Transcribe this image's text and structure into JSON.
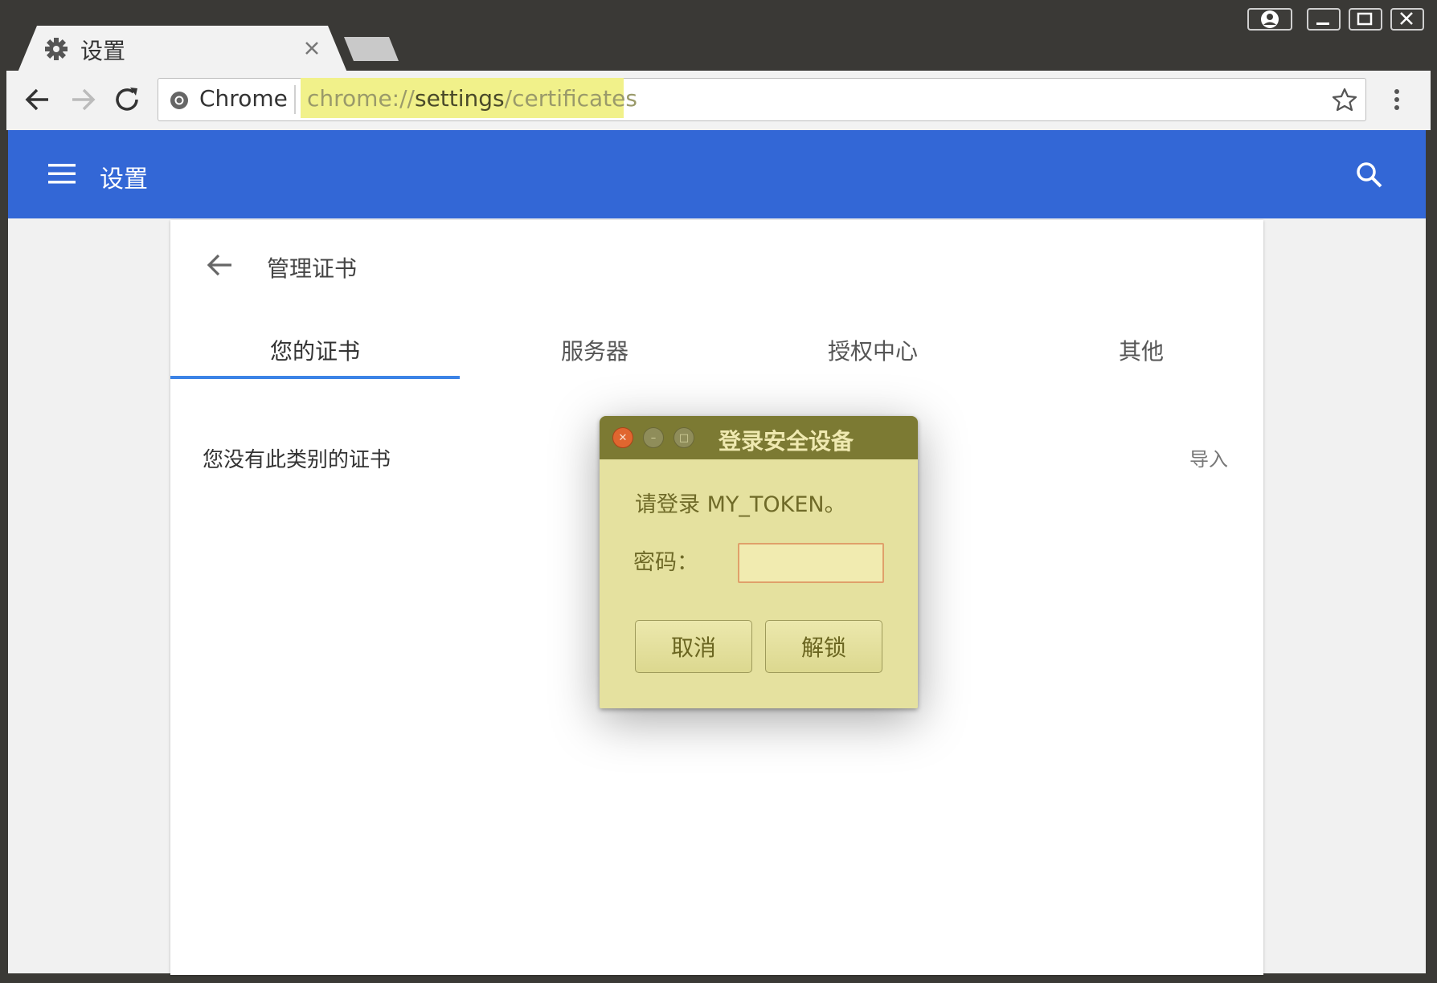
{
  "browser": {
    "tab_title": "设置",
    "omnibox": {
      "scheme_label": "Chrome",
      "url_prefix": "chrome://",
      "url_host": "settings",
      "url_path": "/certificates"
    }
  },
  "header": {
    "title": "设置"
  },
  "page": {
    "title": "管理证书",
    "tabs": [
      {
        "label": "您的证书",
        "active": true
      },
      {
        "label": "服务器",
        "active": false
      },
      {
        "label": "授权中心",
        "active": false
      },
      {
        "label": "其他",
        "active": false
      }
    ],
    "empty_message": "您没有此类别的证书",
    "import_label": "导入"
  },
  "dialog": {
    "title": "登录安全设备",
    "prompt": "请登录 MY_TOKEN。",
    "password_label": "密码：",
    "password_value": "",
    "cancel_label": "取消",
    "unlock_label": "解锁"
  },
  "colors": {
    "header_blue": "#3367d6",
    "tab_indicator": "#3c83e6",
    "dialog_bg": "#e5e19f",
    "dialog_titlebar": "#7c7a33",
    "url_highlight": "#f1f18a"
  }
}
